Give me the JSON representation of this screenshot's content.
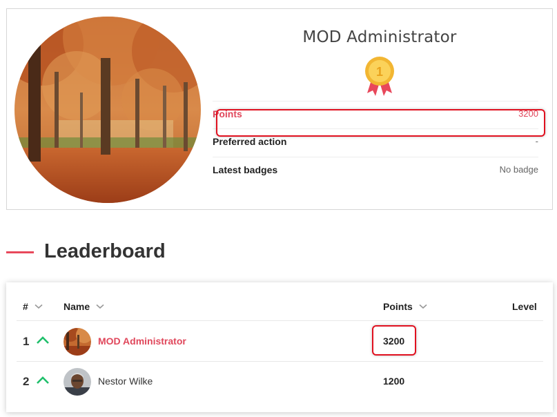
{
  "profile": {
    "name": "MOD Administrator",
    "medal_rank": "1",
    "stats": [
      {
        "label": "Points",
        "value": "3200"
      },
      {
        "label": "Preferred action",
        "value": "-"
      },
      {
        "label": "Latest badges",
        "value": "No badge"
      }
    ]
  },
  "leaderboard": {
    "title": "Leaderboard",
    "columns": {
      "rank": "#",
      "name": "Name",
      "points": "Points",
      "level": "Level"
    },
    "rows": [
      {
        "rank": "1",
        "trend": "up",
        "name": "MOD Administrator",
        "points": "3200",
        "level": ""
      },
      {
        "rank": "2",
        "trend": "up",
        "name": "Nestor Wilke",
        "points": "1200",
        "level": ""
      }
    ]
  },
  "colors": {
    "accent": "#e0475b",
    "trend_up": "#1fbf6b",
    "highlight": "#e0101f",
    "medal_gold": "#f6c343",
    "ribbon": "#e8485b"
  },
  "icons": {
    "medal": "medal-icon",
    "sort": "chevron-down-icon",
    "trend": "chevron-up-icon"
  }
}
